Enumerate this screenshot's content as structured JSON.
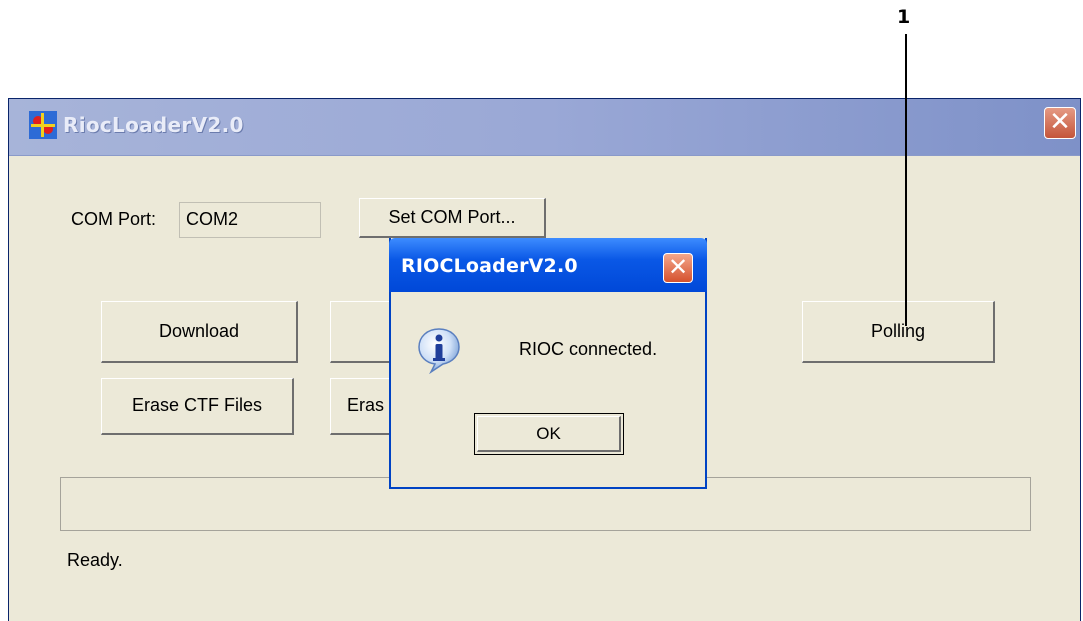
{
  "callout": {
    "number": "1"
  },
  "window": {
    "title": "RiocLoaderV2.0",
    "close_glyph": "✕"
  },
  "com_port": {
    "label": "COM Port:",
    "value": "COM2",
    "set_button": "Set COM Port..."
  },
  "buttons": {
    "download": "Download",
    "polling": "Polling",
    "erase_ctf": "Erase CTF Files",
    "erase_partial": "Eras"
  },
  "status": {
    "text": "Ready."
  },
  "dialog": {
    "title": "RIOCLoaderV2.0",
    "close_glyph": "✕",
    "message": "RIOC connected.",
    "ok_label": "OK",
    "icon": "info-icon"
  },
  "colors": {
    "dialog_title": "#0a58e6",
    "window_bg": "#ece9d8"
  }
}
